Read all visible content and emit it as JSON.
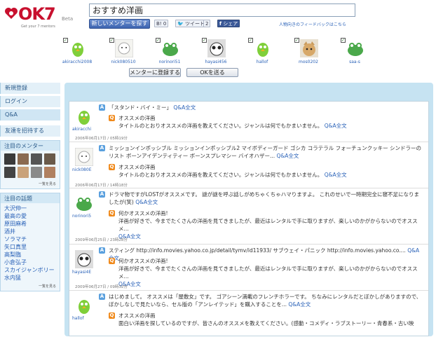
{
  "header": {
    "brand": "OK7",
    "beta": "Beta",
    "tagline": "Get your 7 mentors",
    "search_value": "おすすめ洋画",
    "find_button": "新しいメンターを探す",
    "share_b": "B!",
    "share_b_count": "0",
    "tweet": "ツイート",
    "tweet_count": "2",
    "facebook": "シェア",
    "feedback": "人物向きのフィードバックはこちら"
  },
  "mentors": [
    {
      "name": "akiracchi2008",
      "avatar": "bird"
    },
    {
      "name": "nick080510",
      "avatar": "sheep"
    },
    {
      "name": "norinori51",
      "avatar": "frog"
    },
    {
      "name": "hayasi456",
      "avatar": "panda"
    },
    {
      "name": "hallof",
      "avatar": "bird"
    },
    {
      "name": "mos0202",
      "avatar": "cat"
    },
    {
      "name": "saa-s",
      "avatar": "frog"
    }
  ],
  "actions": {
    "register": "メンターに登録する",
    "send_ok": "OKを送る"
  },
  "sidebar": {
    "nav": [
      "新規登録",
      "ログイン",
      "Q&A"
    ],
    "invite": "友達を招待する",
    "featured_mentors_title": "注目のメンター",
    "featured_more": "一覧を見る",
    "topics_title": "注目の話題",
    "topics": [
      "大沢伸一",
      "最高の愛",
      "原田麻希",
      "酒井",
      "ソラマチ",
      "矢口真里",
      "高梨臨",
      "小倉弘子",
      "スカイジャンボリー",
      "水内猛"
    ],
    "topics_more": "一覧を見る"
  },
  "posts": [
    {
      "user": "akiracchi",
      "avatar": "bird",
      "answer": "「スタンド・バイ・ミー」",
      "answer_link": "Q&A全文",
      "q_title": "オススメの洋画",
      "q_body": "タイトルのとおりオススメの洋画を教えてください。ジャンルは何でもかまいません。",
      "q_link": "Q&A全文",
      "date": "2006年06月17日 / 05時19分"
    },
    {
      "user": "nick080E",
      "avatar": "sheep",
      "answer": "ミッションインポッシブル ミッションインポッシブル2 マイボディーガード ゴシカ コラテラル フォーチュンクッキー シンドラーのリスト ボーンアイデンティティー ボーンスプレマシー バイオハザー...",
      "answer_link": "Q&A全文",
      "q_title": "オススメの洋画",
      "q_body": "タイトルのとおりオススメの洋画を教えてください。ジャンルは何でもかまいません。",
      "q_link": "Q&A全文",
      "date": "2006年06月17日 / 14時18分"
    },
    {
      "user": "norinori5",
      "avatar": "frog",
      "answer": "ドラマ物ですがLOSTがオススメです。 謎が謎を呼ぶ話しがめちゃくちゃハマりますよ。 これのせいで一時期完全に寝不足になりましたが(笑)",
      "answer_link": "Q&A全文",
      "q_title": "何かオススメの洋画!",
      "q_body": "洋画が好きで、今までたくさんの洋画を見てきましたが、最近はレンタルで手に取りますが、楽しいのかがからないのでオススメ...",
      "q_link": "Q&A全文",
      "date": "2009年06月25日 / 23時28分"
    },
    {
      "user": "hayasi4E",
      "avatar": "panda",
      "answer": "スティング http://info.movies.yahoo.co.jp/detail/tymv/id11933/ サブウェイ・パニック http://info.movies.yahoo.co....",
      "answer_link": "Q&A全文",
      "q_title": "何かオススメの洋画!",
      "q_body": "洋画が好きで、今までたくさんの洋画を見てきましたが、最近はレンタルで手に取りますが、楽しいのかがからないのでオススメ...",
      "q_link": "Q&A全文",
      "date": "2009年06月27日 / 09時32分"
    },
    {
      "user": "hallof",
      "avatar": "bird",
      "answer": "はじめまして。 オススメは「屋敷女」です。 ゴアシーン満載のフレンチホラーです。 ちなみにレンタルだとぼかしがありますので、ぼかしなしで見たいなら、セル版の「アンレイテッド」を購入することを...",
      "answer_link": "Q&A全文",
      "q_title": "オススメの洋画",
      "q_body": "面白い洋画を探しているのですが、皆さんのオススメを教えてください。(感動・コメディ・ラブストーリー・青春系・古い映",
      "q_link": "",
      "date": ""
    }
  ],
  "colors": {
    "brand": "#c8102e",
    "link": "#2a62b8",
    "panel_bg": "#c6e3f2",
    "answer_badge": "#5aa0de",
    "question_badge": "#f08a1c"
  }
}
